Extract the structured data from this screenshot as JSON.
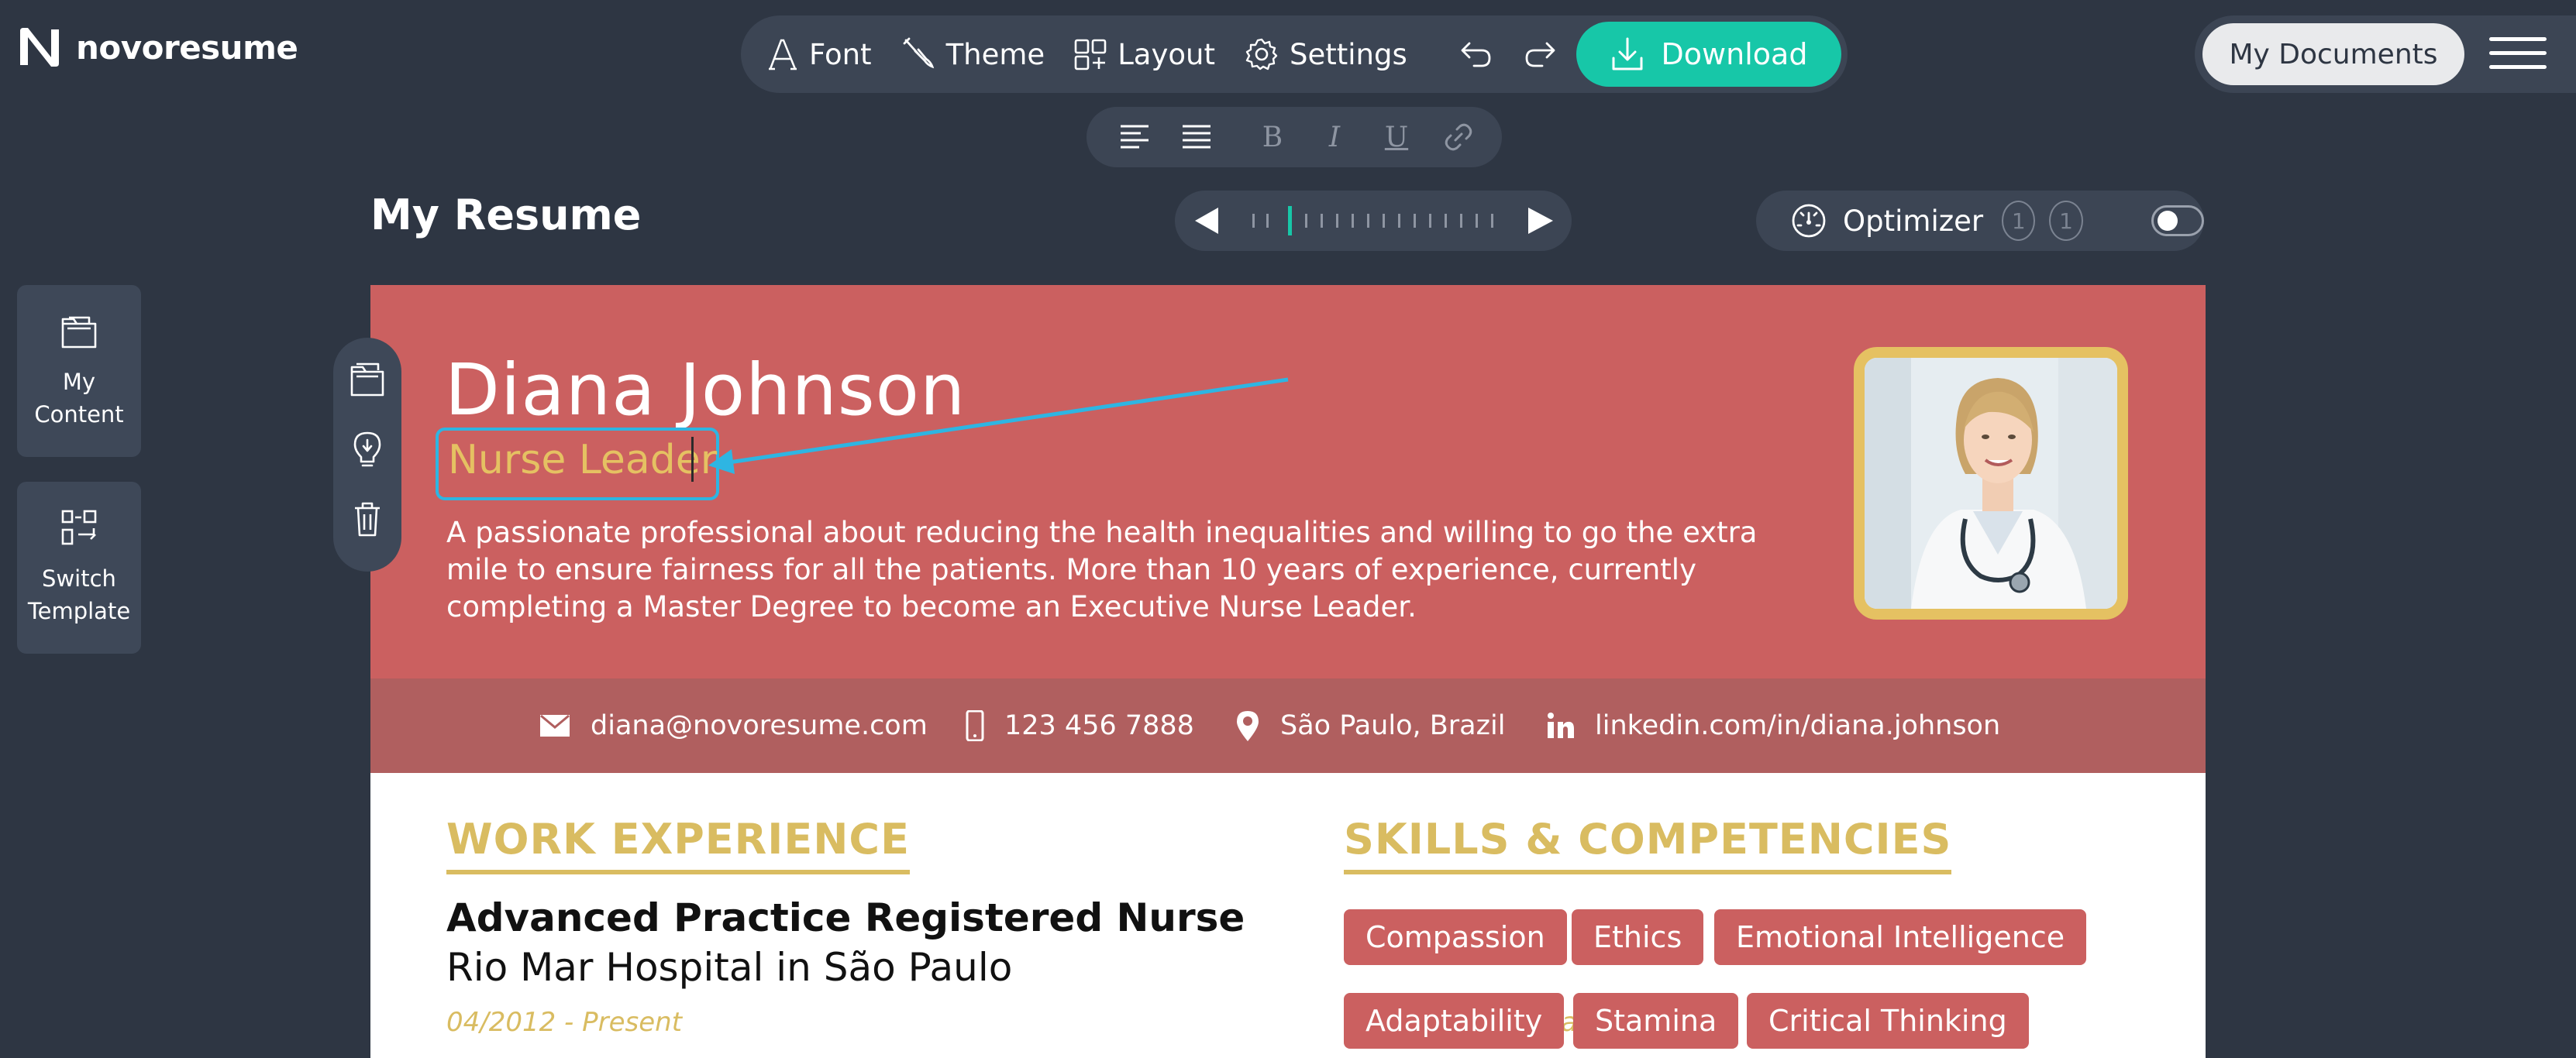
{
  "app": {
    "logo_text": "novoresume"
  },
  "toolbar": {
    "font_label": "Font",
    "theme_label": "Theme",
    "layout_label": "Layout",
    "settings_label": "Settings",
    "download_label": "Download",
    "accent_color": "#17c7a8"
  },
  "nav": {
    "my_documents_label": "My Documents"
  },
  "format": {
    "bold": "B",
    "italic": "I",
    "underline": "U"
  },
  "page": {
    "title": "My Resume"
  },
  "optimizer": {
    "label": "Optimizer",
    "badges": [
      "1",
      "1"
    ],
    "enabled": false
  },
  "sidebar": {
    "items": [
      {
        "label_line1": "My",
        "label_line2": "Content",
        "icon": "folder-icon"
      },
      {
        "label_line1": "Switch",
        "label_line2": "Template",
        "icon": "switch-template-icon"
      }
    ]
  },
  "resume": {
    "name": "Diana Johnson",
    "subtitle": "Nurse Leader",
    "summary": "A passionate professional about reducing the health inequalities and willing to go the extra mile to ensure fairness for all the patients. More than 10 years of experience, currently completing a Master Degree to become an Executive Nurse Leader.",
    "header_color": "#cb6060",
    "accent_color": "#d9bc61",
    "contact": {
      "email": "diana@novoresume.com",
      "phone": "123 456 7888",
      "location": "São Paulo, Brazil",
      "linkedin": "linkedin.com/in/diana.johnson"
    },
    "work_experience": {
      "heading": "WORK EXPERIENCE",
      "job_title": "Advanced Practice Registered Nurse",
      "company": "Rio Mar Hospital in São Paulo",
      "dates": "04/2012 - Present",
      "location": "São Paulo, Brazil"
    },
    "skills": {
      "heading": "SKILLS & COMPETENCIES",
      "items": [
        "Compassion",
        "Ethics",
        "Emotional Intelligence",
        "Adaptability",
        "Stamina",
        "Critical Thinking"
      ]
    }
  }
}
